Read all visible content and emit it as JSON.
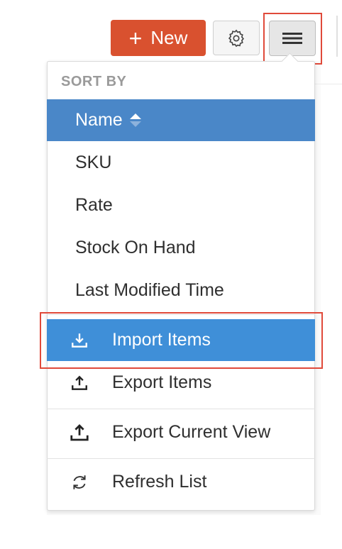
{
  "toolbar": {
    "new_label": "New",
    "new_icon": "plus-icon",
    "settings_icon": "gear-icon",
    "menu_icon": "hamburger-icon"
  },
  "dropdown": {
    "section_title": "SORT BY",
    "sort_options": [
      {
        "label": "Name",
        "selected": true
      },
      {
        "label": "SKU"
      },
      {
        "label": "Rate"
      },
      {
        "label": "Stock On Hand"
      },
      {
        "label": "Last Modified Time"
      }
    ],
    "actions": [
      {
        "label": "Import Items",
        "icon": "download-icon",
        "highlighted": true
      },
      {
        "label": "Export Items",
        "icon": "upload-icon"
      },
      {
        "label": "Export Current View",
        "icon": "upload-icon"
      },
      {
        "label": "Refresh List",
        "icon": "refresh-icon"
      }
    ]
  },
  "colors": {
    "new_button": "#d9512f",
    "selected_row": "#4a87c8",
    "highlight_row": "#3f8fd8",
    "annotation_outline": "#e04a3a"
  }
}
